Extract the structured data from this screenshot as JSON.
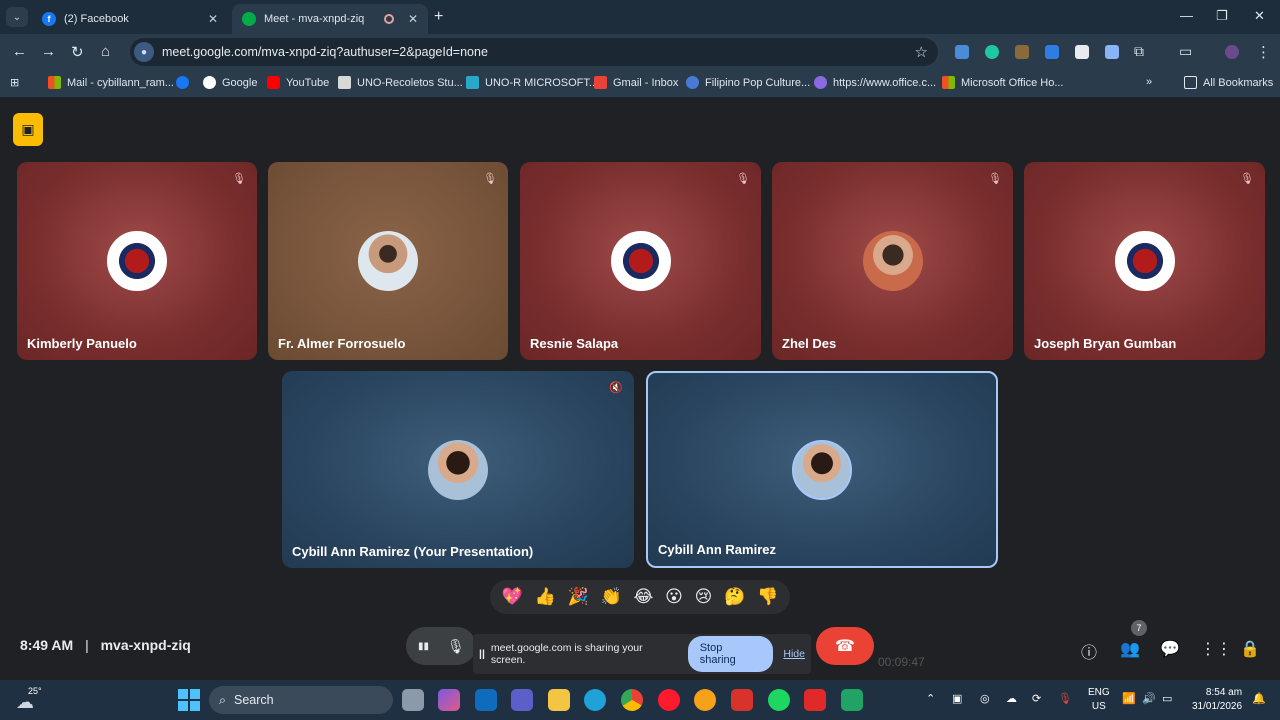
{
  "browser": {
    "tabs": [
      {
        "title": "(2) Facebook",
        "active": false
      },
      {
        "title": "Meet - mva-xnpd-ziq",
        "active": true
      }
    ],
    "url": "meet.google.com/mva-xnpd-ziq?authuser=2&pageId=none",
    "bookmarks": [
      "Mail - cybillann_ram...",
      "",
      "Google",
      "YouTube",
      "UNO-Recoletos Stu...",
      "UNO-R MICROSOFT...",
      "Gmail - Inbox",
      "Filipino Pop Culture...",
      "https://www.office.c...",
      "Microsoft Office Ho..."
    ],
    "all_bookmarks": "All Bookmarks"
  },
  "meet": {
    "participants_top": [
      {
        "name": "Kimberly Panuelo",
        "muted": true
      },
      {
        "name": "Fr. Almer Forrosuelo",
        "muted": true
      },
      {
        "name": "Resnie Salapa",
        "muted": true
      },
      {
        "name": "Zhel Des",
        "muted": true
      },
      {
        "name": "Joseph Bryan Gumban",
        "muted": true
      }
    ],
    "participants_bottom": [
      {
        "name": "Cybill Ann Ramirez (Your Presentation)"
      },
      {
        "name": "Cybill Ann Ramirez"
      }
    ],
    "reactions": [
      "💖",
      "👍",
      "🎉",
      "👏",
      "😂",
      "😮",
      "😢",
      "🤔",
      "👎"
    ],
    "time": "8:49 AM",
    "separator": "|",
    "meeting_code": "mva-xnpd-ziq",
    "share_bar": {
      "message": "meet.google.com is sharing your screen.",
      "stop_label": "Stop sharing",
      "hide_label": "Hide"
    },
    "recording_timer": "00:09:47",
    "people_count": "7"
  },
  "taskbar": {
    "temperature": "25°",
    "search_label": "Search",
    "lang_line1": "ENG",
    "lang_line2": "US",
    "clock_time": "8:54 am",
    "clock_date": "31/01/2026"
  }
}
